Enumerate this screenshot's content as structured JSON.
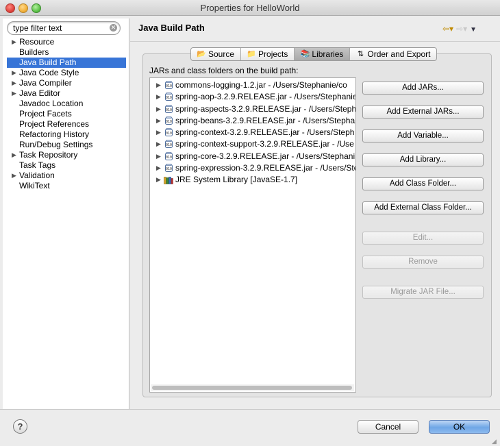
{
  "window": {
    "title": "Properties for HelloWorld"
  },
  "filter": {
    "value": "type filter text"
  },
  "sidebar": {
    "items": [
      {
        "label": "Resource",
        "expandable": true
      },
      {
        "label": "Builders",
        "expandable": false
      },
      {
        "label": "Java Build Path",
        "expandable": false,
        "selected": true
      },
      {
        "label": "Java Code Style",
        "expandable": true
      },
      {
        "label": "Java Compiler",
        "expandable": true
      },
      {
        "label": "Java Editor",
        "expandable": true
      },
      {
        "label": "Javadoc Location",
        "expandable": false
      },
      {
        "label": "Project Facets",
        "expandable": false
      },
      {
        "label": "Project References",
        "expandable": false
      },
      {
        "label": "Refactoring History",
        "expandable": false
      },
      {
        "label": "Run/Debug Settings",
        "expandable": false
      },
      {
        "label": "Task Repository",
        "expandable": true
      },
      {
        "label": "Task Tags",
        "expandable": false
      },
      {
        "label": "Validation",
        "expandable": true
      },
      {
        "label": "WikiText",
        "expandable": false
      }
    ]
  },
  "page": {
    "title": "Java Build Path"
  },
  "tabs": [
    {
      "label": "Source",
      "icon": "source-folder-icon",
      "active": false
    },
    {
      "label": "Projects",
      "icon": "projects-icon",
      "active": false
    },
    {
      "label": "Libraries",
      "icon": "libraries-icon",
      "active": true
    },
    {
      "label": "Order and Export",
      "icon": "order-export-icon",
      "active": false
    }
  ],
  "libraries": {
    "list_label": "JARs and class folders on the build path:",
    "entries": [
      {
        "text": "commons-logging-1.2.jar - /Users/Stephanie/co",
        "icon": "jar-icon"
      },
      {
        "text": "spring-aop-3.2.9.RELEASE.jar - /Users/Stephanie",
        "icon": "jar-icon"
      },
      {
        "text": "spring-aspects-3.2.9.RELEASE.jar - /Users/Steph",
        "icon": "jar-icon"
      },
      {
        "text": "spring-beans-3.2.9.RELEASE.jar - /Users/Stephan",
        "icon": "jar-icon"
      },
      {
        "text": "spring-context-3.2.9.RELEASE.jar - /Users/Steph",
        "icon": "jar-icon"
      },
      {
        "text": "spring-context-support-3.2.9.RELEASE.jar - /Use",
        "icon": "jar-icon"
      },
      {
        "text": "spring-core-3.2.9.RELEASE.jar - /Users/Stephani",
        "icon": "jar-icon"
      },
      {
        "text": "spring-expression-3.2.9.RELEASE.jar - /Users/Ste",
        "icon": "jar-icon"
      },
      {
        "text": "JRE System Library [JavaSE-1.7]",
        "icon": "jre-library-icon"
      }
    ],
    "buttons": {
      "add_jars": "Add JARs...",
      "add_external_jars": "Add External JARs...",
      "add_variable": "Add Variable...",
      "add_library": "Add Library...",
      "add_class_folder": "Add Class Folder...",
      "add_external_class_folder": "Add External Class Folder...",
      "edit": "Edit...",
      "remove": "Remove",
      "migrate_jar": "Migrate JAR File..."
    }
  },
  "footer": {
    "help": "?",
    "cancel": "Cancel",
    "ok": "OK"
  },
  "colors": {
    "selection": "#3875d7",
    "default_button": "#6fa6e6",
    "nav_arrow": "#c08a00"
  }
}
